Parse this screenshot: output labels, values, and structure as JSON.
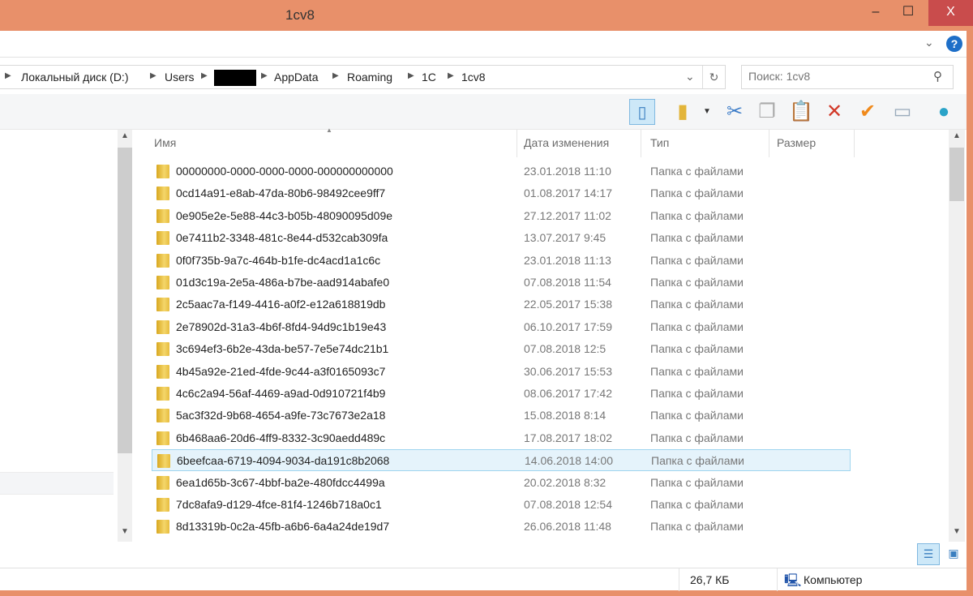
{
  "window": {
    "title": "1cv8",
    "minimize": "–",
    "maximize": "☐",
    "close": "X"
  },
  "address": {
    "crumbs": [
      "Локальный диск (D:)",
      "Users",
      "AppData",
      "Roaming",
      "1C",
      "1cv8"
    ]
  },
  "search": {
    "placeholder": "Поиск: 1cv8"
  },
  "columns": {
    "name": "Имя",
    "date": "Дата изменения",
    "type": "Тип",
    "size": "Размер"
  },
  "files": [
    {
      "name": "00000000-0000-0000-0000-000000000000",
      "date": "23.01.2018 11:10",
      "type": "Папка с файлами"
    },
    {
      "name": "0cd14a91-e8ab-47da-80b6-98492cee9ff7",
      "date": "01.08.2017 14:17",
      "type": "Папка с файлами"
    },
    {
      "name": "0e905e2e-5e88-44c3-b05b-48090095d09e",
      "date": "27.12.2017 11:02",
      "type": "Папка с файлами"
    },
    {
      "name": "0e7411b2-3348-481c-8e44-d532cab309fa",
      "date": "13.07.2017 9:45",
      "type": "Папка с файлами"
    },
    {
      "name": "0f0f735b-9a7c-464b-b1fe-dc4acd1a1c6c",
      "date": "23.01.2018 11:13",
      "type": "Папка с файлами"
    },
    {
      "name": "01d3c19a-2e5a-486a-b7be-aad914abafe0",
      "date": "07.08.2018 11:54",
      "type": "Папка с файлами"
    },
    {
      "name": "2c5aac7a-f149-4416-a0f2-e12a618819db",
      "date": "22.05.2017 15:38",
      "type": "Папка с файлами"
    },
    {
      "name": "2e78902d-31a3-4b6f-8fd4-94d9c1b19e43",
      "date": "06.10.2017 17:59",
      "type": "Папка с файлами"
    },
    {
      "name": "3c694ef3-6b2e-43da-be57-7e5e74dc21b1",
      "date": "07.08.2018 12:5",
      "type": "Папка с файлами"
    },
    {
      "name": "4b45a92e-21ed-4fde-9c44-a3f0165093c7",
      "date": "30.06.2017 15:53",
      "type": "Папка с файлами"
    },
    {
      "name": "4c6c2a94-56af-4469-a9ad-0d910721f4b9",
      "date": "08.06.2017 17:42",
      "type": "Папка с файлами"
    },
    {
      "name": "5ac3f32d-9b68-4654-a9fe-73c7673e2a18",
      "date": "15.08.2018 8:14",
      "type": "Папка с файлами"
    },
    {
      "name": "6b468aa6-20d6-4ff9-8332-3c90aedd489c",
      "date": "17.08.2017 18:02",
      "type": "Папка с файлами"
    },
    {
      "name": "6beefcaa-6719-4094-9034-da191c8b2068",
      "date": "14.06.2018 14:00",
      "type": "Папка с файлами"
    },
    {
      "name": "6ea1d65b-3c67-4bbf-ba2e-480fdcc4499a",
      "date": "20.02.2018 8:32",
      "type": "Папка с файлами"
    },
    {
      "name": "7dc8afa9-d129-4fce-81f4-1246b718a0c1",
      "date": "07.08.2018 12:54",
      "type": "Папка с файлами"
    },
    {
      "name": "8d13319b-0c2a-45fb-a6b6-6a4a24de19d7",
      "date": "26.06.2018 11:48",
      "type": "Папка с файлами"
    }
  ],
  "selected_index": 13,
  "status": {
    "size": "26,7 КБ",
    "location": "Компьютер"
  }
}
